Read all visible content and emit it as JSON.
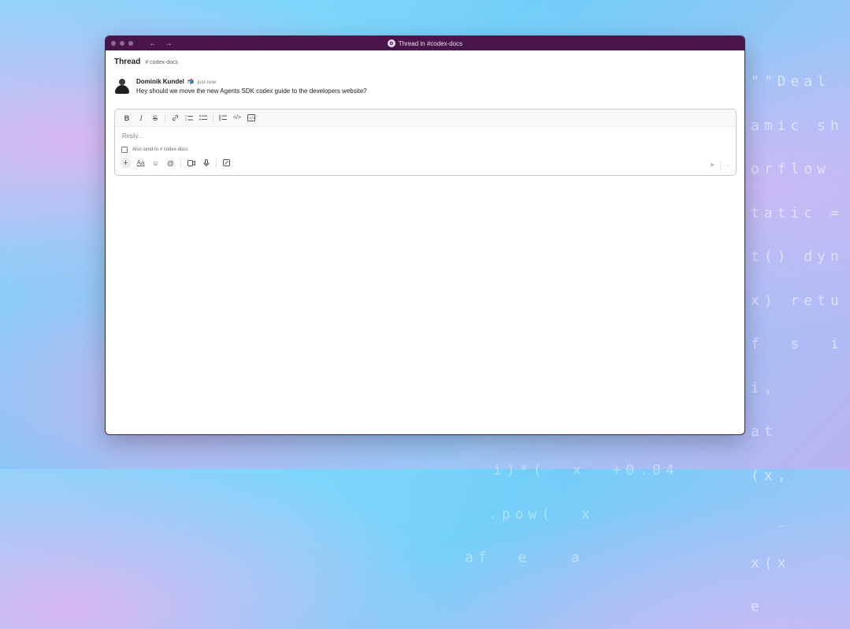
{
  "window": {
    "title": "Thread in #codex-docs"
  },
  "thread": {
    "title": "Thread",
    "channel": "# codex-docs"
  },
  "message": {
    "author": "Dominik Kundel",
    "status": "📬",
    "time": "just now",
    "text": "Hey should we move the new Agents SDK codex guide to the developers website?"
  },
  "composer": {
    "placeholder": "Reply...",
    "also_send_label": "Also send to # codex-docs"
  },
  "background_code": [
    "\"\"Deal",
    "amic sh",
    "orflow",
    "tatic =",
    "t() dyn",
    "x) retu",
    "f  s  i",
    "i,",
    "at",
    "(x,",
    "  _",
    "x(x",
    "e"
  ],
  "background_code_bottom": [
    "i)*(  x  +0.04",
    ".pow(  x",
    "af  e   a"
  ],
  "icons": {
    "bold": "B",
    "italic": "I",
    "strike": "S",
    "link": "link-icon",
    "ordered_list": "ordered-list-icon",
    "bullet_list": "bullet-list-icon",
    "blockquote": "blockquote-icon",
    "code": "code-icon",
    "code_block": "code-block-icon"
  }
}
